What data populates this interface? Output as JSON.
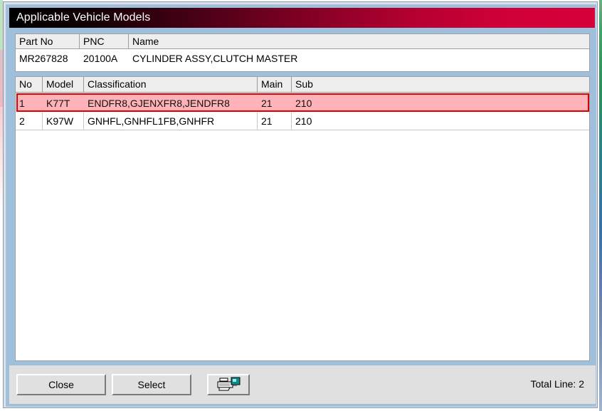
{
  "window": {
    "title": "Applicable Vehicle Models"
  },
  "part_info": {
    "columns": [
      "Part No",
      "PNC",
      "Name"
    ],
    "row": {
      "part_no": "MR267828",
      "pnc": "20100A",
      "name": "CYLINDER ASSY,CLUTCH MASTER"
    }
  },
  "grid": {
    "columns": [
      "No",
      "Model",
      "Classification",
      "Main",
      "Sub"
    ],
    "rows": [
      {
        "no": "1",
        "model": "K77T",
        "classification": "ENDFR8,GJENXFR8,JENDFR8",
        "main": "21",
        "sub": "210",
        "selected": true
      },
      {
        "no": "2",
        "model": "K97W",
        "classification": "GNHFL,GNHFL1FB,GNHFR",
        "main": "21",
        "sub": "210",
        "selected": false
      }
    ]
  },
  "footer": {
    "close_label": "Close",
    "select_label": "Select",
    "print_icon": "printer-icon",
    "total_line": "Total Line: 2"
  },
  "colors": {
    "title_gradient_start": "#000000",
    "title_gradient_end": "#d60039",
    "selection_fill": "#ffb3b8",
    "selection_border": "#dd0000",
    "dialog_face": "#e0e0e0",
    "dialog_border": "#9fc0dd"
  }
}
